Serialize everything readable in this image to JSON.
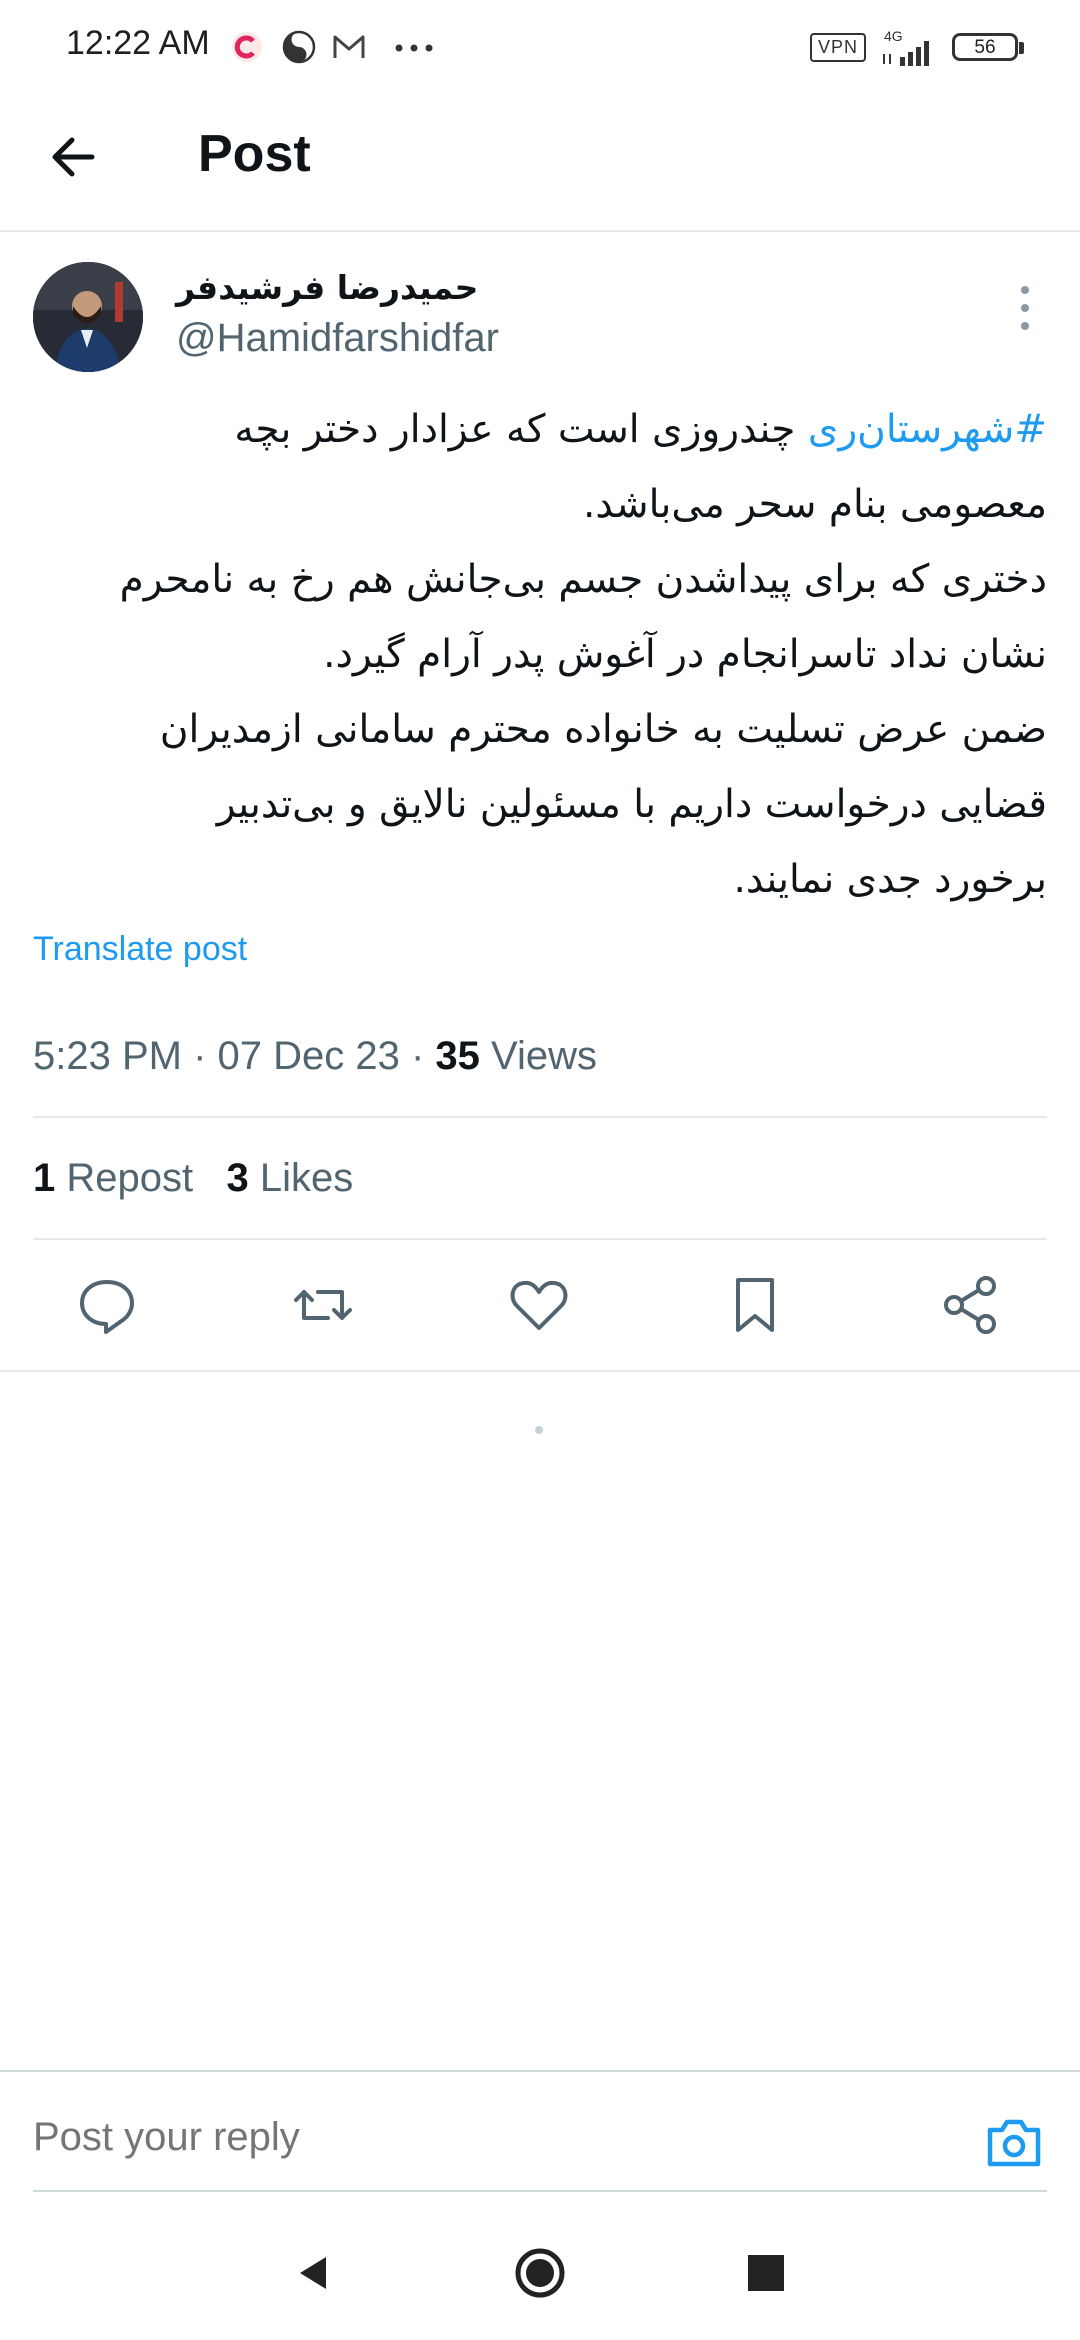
{
  "status_bar": {
    "time": "12:22 AM",
    "notification_icons": [
      "c-app-icon",
      "yin-yang-icon",
      "gmail-icon",
      "more-dots-icon"
    ],
    "vpn": "VPN",
    "network": "4G",
    "battery": "56"
  },
  "header": {
    "title": "Post"
  },
  "post": {
    "author_name": "حمیدرضا فرشیدفر",
    "author_handle": "@Hamidfarshidfar",
    "hashtag": "#شهرستان‌ری",
    "lines": [
      " چندروزی است که عزادار دختر بچه",
      "معصومی بنام سحر می‌باشد.",
      "دختری که برای پیداشدن جسم بی‌جانش هم رخ به نامحرم",
      "نشان نداد تاسرانجام در آغوش پدر آرام گیرد.",
      "ضمن عرض تسلیت به خانواده محترم سامانی ازمدیران",
      "قضایی درخواست داریم با مسئولین نالایق و بی‌تدبیر",
      "برخورد جدی نمایند."
    ],
    "translate_label": "Translate post",
    "time": "5:23 PM",
    "date": "07 Dec 23",
    "views_count": "35",
    "views_label": "Views",
    "reposts_count": "1",
    "reposts_label": "Repost",
    "likes_count": "3",
    "likes_label": "Likes"
  },
  "reply": {
    "placeholder": "Post your reply"
  },
  "colors": {
    "accent": "#1d9bf0",
    "text": "#0f1419",
    "secondary": "#536471"
  }
}
